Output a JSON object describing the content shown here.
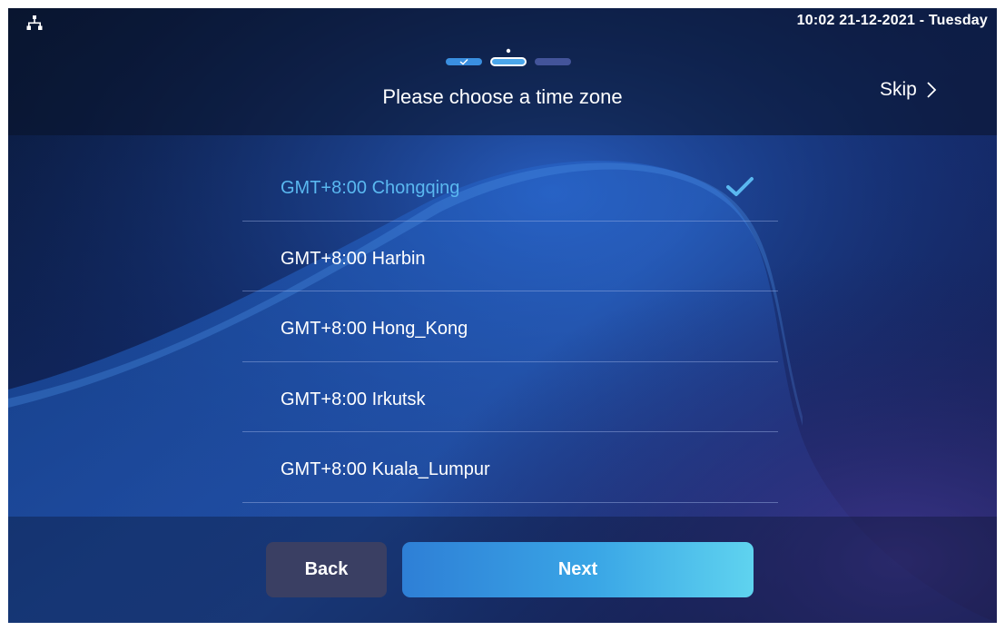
{
  "status_bar": {
    "datetime": "10:02  21-12-2021 - Tuesday",
    "network_icon": "network-icon"
  },
  "stepper": {
    "total_steps": 3,
    "current_step": 2,
    "completed_steps": 1
  },
  "title": "Please choose a time zone",
  "skip": {
    "label": "Skip",
    "icon": "chevron-right-icon"
  },
  "timezones": [
    {
      "label": "GMT+8:00 Chongqing",
      "selected": true
    },
    {
      "label": "GMT+8:00 Harbin",
      "selected": false
    },
    {
      "label": "GMT+8:00 Hong_Kong",
      "selected": false
    },
    {
      "label": "GMT+8:00 Irkutsk",
      "selected": false
    },
    {
      "label": "GMT+8:00 Kuala_Lumpur",
      "selected": false
    }
  ],
  "buttons": {
    "back": "Back",
    "next": "Next"
  },
  "colors": {
    "accent": "#5ab8f0",
    "background": "#0b1530",
    "back_button": "#3a3f63",
    "next_gradient_start": "#2e7fd6",
    "next_gradient_end": "#5fd3ef"
  }
}
